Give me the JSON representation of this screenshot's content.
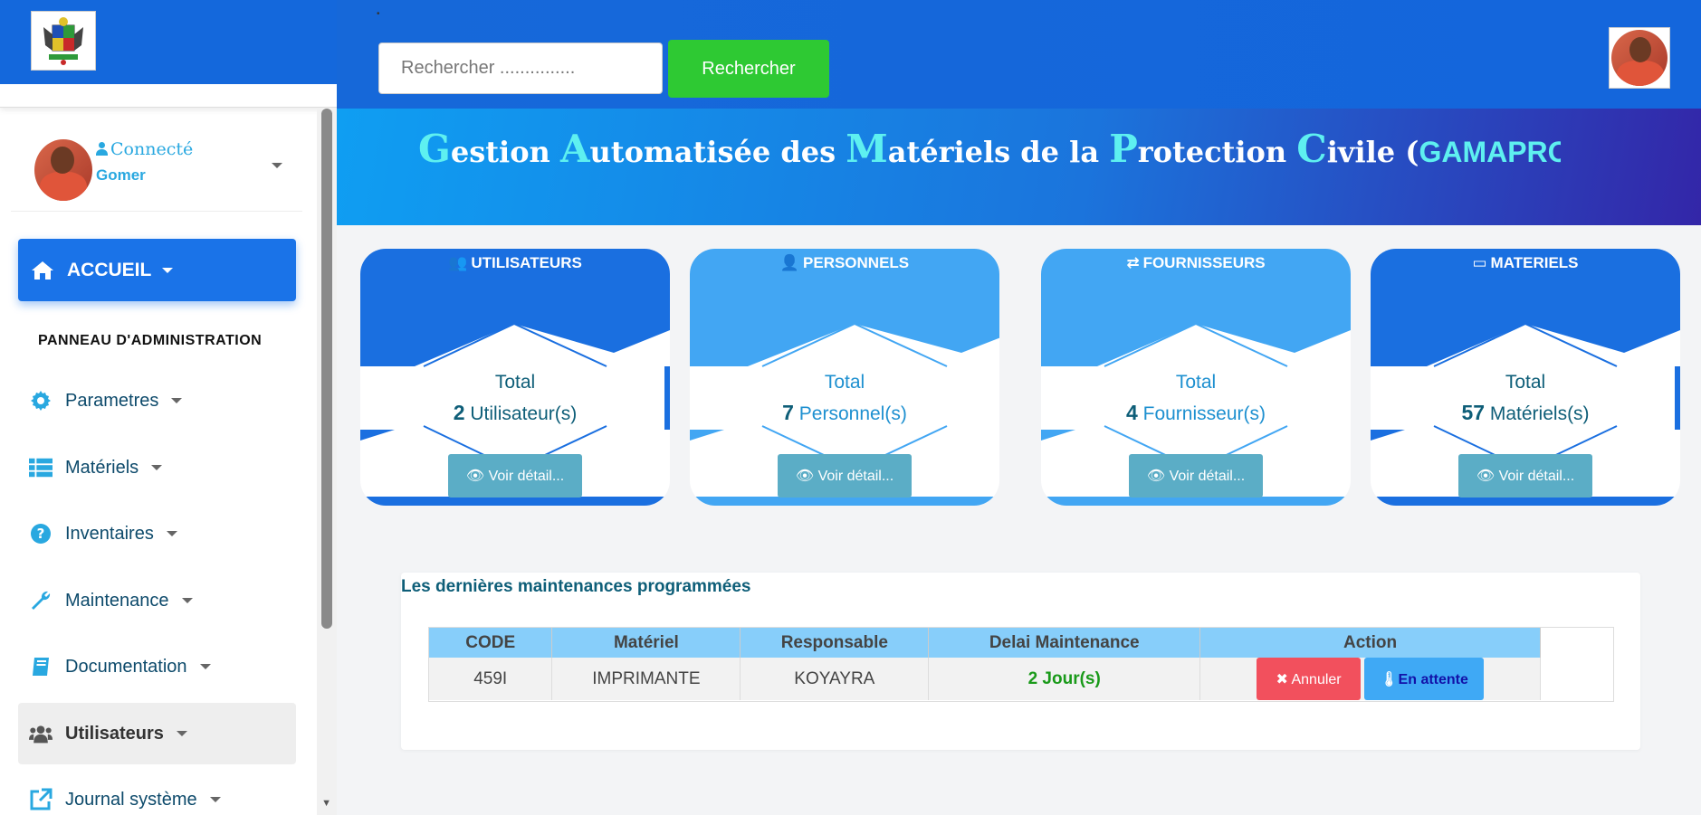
{
  "header": {
    "search_placeholder": "Rechercher ...............",
    "search_button": "Rechercher"
  },
  "user": {
    "status": "Connecté",
    "name": "Gomer"
  },
  "sidebar": {
    "home_label": "ACCUEIL",
    "panel_title": "PANNEAU D'ADMINISTRATION",
    "items": [
      {
        "label": "Parametres",
        "icon": "gear-icon"
      },
      {
        "label": "Matériels",
        "icon": "list-icon"
      },
      {
        "label": "Inventaires",
        "icon": "question-icon"
      },
      {
        "label": "Maintenance",
        "icon": "wrench-icon"
      },
      {
        "label": "Documentation",
        "icon": "book-icon"
      },
      {
        "label": "Utilisateurs",
        "icon": "users-icon"
      },
      {
        "label": "Journal système",
        "icon": "external-link-icon"
      }
    ]
  },
  "banner": {
    "caps": [
      "G",
      "A",
      "M",
      "P",
      "C"
    ],
    "parts": [
      "estion ",
      "utomatisée des ",
      "atériels de la ",
      "rotection ",
      "ivile ("
    ],
    "abbr": "GAMAPROC)"
  },
  "cards": [
    {
      "title": "UTILISATEURS",
      "total_label": "Total",
      "count": "2",
      "unit": "Utilisateur(s)",
      "button": "Voir détail...",
      "color": "#1a6fe0",
      "text_color": "#0e5e78"
    },
    {
      "title": "PERSONNELS",
      "total_label": "Total",
      "count": "7",
      "unit": "Personnel(s)",
      "button": "Voir détail...",
      "color": "#42a6f3",
      "text_color": "#1e90d0"
    },
    {
      "title": "FOURNISSEURS",
      "total_label": "Total",
      "count": "4",
      "unit": "Fournisseur(s)",
      "button": "Voir détail...",
      "color": "#42a6f3",
      "text_color": "#1e90d0"
    },
    {
      "title": "MATERIELS",
      "total_label": "Total",
      "count": "57",
      "unit": "Matériels(s)",
      "button": "Voir détail...",
      "color": "#1a6fe0",
      "text_color": "#0e5e78"
    }
  ],
  "maintenance": {
    "title": "Les dernières maintenances programmées",
    "columns": [
      "CODE",
      "Matériel",
      "Responsable",
      "Delai Maintenance",
      "Action"
    ],
    "rows": [
      {
        "code": "459I",
        "materiel": "IMPRIMANTE",
        "responsable": "KOYAYRA",
        "delai": "2 Jour(s)",
        "cancel": "Annuler",
        "status": "En attente"
      }
    ]
  },
  "colors": {
    "primary": "#1a73e8",
    "success": "#2ec933",
    "danger": "#f2505d",
    "info": "#3fa9f5"
  }
}
